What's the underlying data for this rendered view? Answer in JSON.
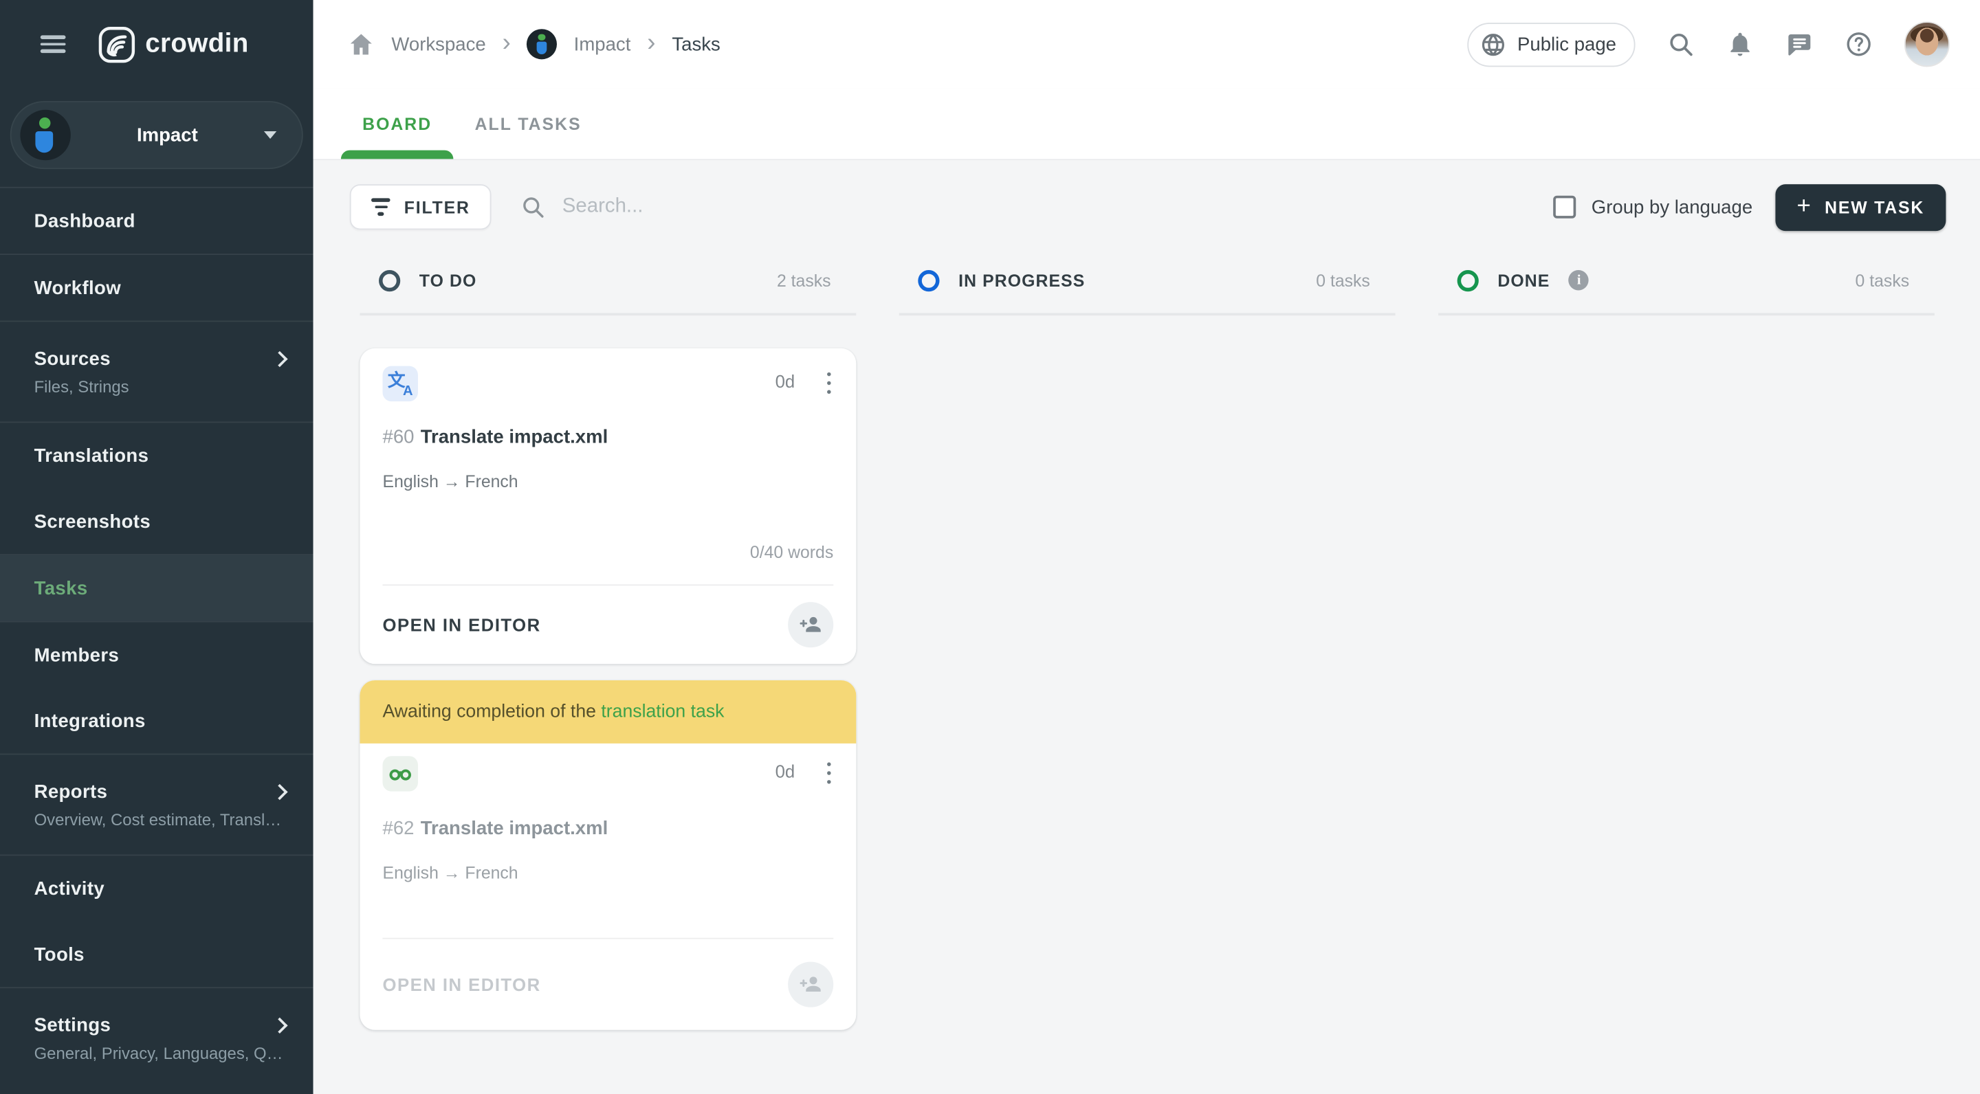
{
  "app": {
    "logo_text": "crowdin"
  },
  "sidebar": {
    "project": {
      "name": "Impact"
    },
    "items": [
      {
        "label": "Dashboard"
      },
      {
        "label": "Workflow"
      },
      {
        "label": "Sources",
        "subtitle": "Files, Strings"
      },
      {
        "label": "Translations"
      },
      {
        "label": "Screenshots"
      },
      {
        "label": "Tasks"
      },
      {
        "label": "Members"
      },
      {
        "label": "Integrations"
      },
      {
        "label": "Reports",
        "subtitle": "Overview, Cost estimate, Transl…"
      },
      {
        "label": "Activity"
      },
      {
        "label": "Tools"
      },
      {
        "label": "Settings",
        "subtitle": "General, Privacy, Languages, Q…"
      }
    ]
  },
  "header": {
    "breadcrumb": {
      "workspace": "Workspace",
      "project": "Impact",
      "page": "Tasks"
    },
    "public_page_label": "Public page"
  },
  "tabs": {
    "board": "BOARD",
    "all_tasks": "ALL TASKS"
  },
  "toolbar": {
    "filter_label": "FILTER",
    "search_placeholder": "Search...",
    "group_by_language_label": "Group by language",
    "new_task_label": "NEW TASK",
    "new_task_plus": "+"
  },
  "board": {
    "columns": [
      {
        "name": "TO DO",
        "count": "2 tasks"
      },
      {
        "name": "IN PROGRESS",
        "count": "0 tasks"
      },
      {
        "name": "DONE",
        "count": "0 tasks",
        "info_icon": "i"
      }
    ],
    "cards": [
      {
        "id": "#60",
        "title": "Translate impact.xml",
        "languages": "English → French",
        "due": "0d",
        "words": "0/40 words",
        "action": "OPEN IN EDITOR",
        "type_icon": "translate-icon",
        "glyph_zh": "文",
        "glyph_la": "A"
      },
      {
        "id": "#62",
        "title": "Translate impact.xml",
        "languages": "English → French",
        "due": "0d",
        "action": "OPEN IN EDITOR",
        "type_icon": "proofread-icon",
        "banner": {
          "text": "Awaiting completion of the",
          "link": "translation task"
        }
      }
    ]
  },
  "icons": [
    "hamburger-menu-icon",
    "crowdin-logo",
    "home-icon",
    "globe-icon",
    "search-icon",
    "bell-icon",
    "chat-icon",
    "help-icon",
    "filter-icon",
    "plus-icon",
    "kebab-menu-icon",
    "translate-icon",
    "proofread-icon",
    "person-add-icon",
    "info-icon",
    "chevron-right-icon",
    "caret-down-icon",
    "checkbox"
  ],
  "colors": {
    "accent_green": "#3da14a",
    "sidebar_bg": "#25323a",
    "sidebar_active_green": "#6cab79",
    "banner_yellow": "#f5d877",
    "in_progress_blue": "#1266d8",
    "done_green": "#16954e",
    "todo_ring": "#3e5460",
    "new_task_bg": "#25323a",
    "content_bg": "#f4f5f6"
  }
}
